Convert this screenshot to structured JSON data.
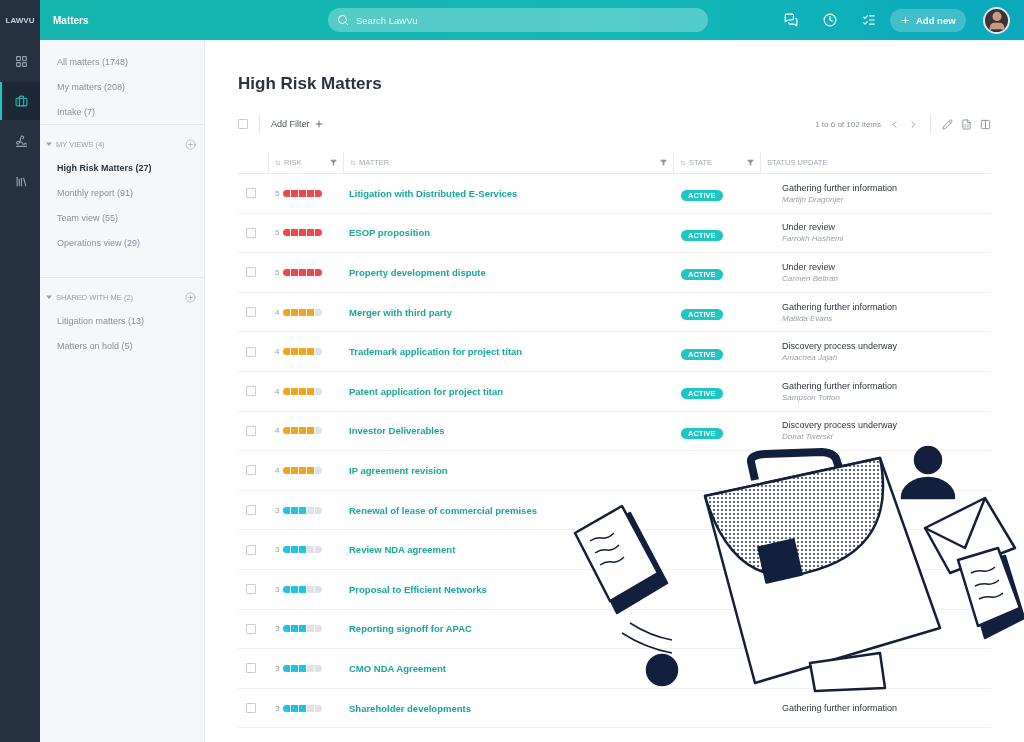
{
  "logo": "LAWVU",
  "nav_rail": [
    {
      "kind": "grid",
      "selected": false
    },
    {
      "kind": "briefcase",
      "selected": true
    },
    {
      "kind": "signature",
      "selected": false
    },
    {
      "kind": "library",
      "selected": false
    }
  ],
  "top_bar": {
    "title": "Matters",
    "search": {
      "placeholder": "Search LawVu"
    },
    "add_button": "Add new"
  },
  "sidebar": {
    "items": [
      {
        "label": "All matters (1748)",
        "selected": false
      },
      {
        "label": "My matters (208)",
        "selected": false
      },
      {
        "label": "Intake (7)",
        "selected": false
      }
    ],
    "sections": [
      {
        "title": "MY VIEWS (4)",
        "expanded": true,
        "items": [
          {
            "label": "High Risk Matters (27)",
            "selected": true
          },
          {
            "label": "Monthly report (91)",
            "selected": false
          },
          {
            "label": "Team view (55)",
            "selected": false
          },
          {
            "label": "Operations view (29)",
            "selected": false
          }
        ]
      },
      {
        "title": "SHARED WITH ME (2)",
        "expanded": true,
        "items": [
          {
            "label": "Litigation matters (13)",
            "selected": false
          },
          {
            "label": "Matters on hold (5)",
            "selected": false
          }
        ]
      }
    ]
  },
  "page_title": "High Risk Matters",
  "toolbar": {
    "select_all": {
      "checked": false
    },
    "add_filter": "Add Filter",
    "pagination": "1 to 6 of 102 items"
  },
  "table": {
    "columns": [
      "RISK",
      "MATTER",
      "STATE",
      "STATUS UPDATE"
    ],
    "rows": [
      {
        "checked": false,
        "risk": "5",
        "level": 1,
        "matter": "Litigation with Distributed E-Services",
        "state": "ACTIVE",
        "status": "Gathering further information",
        "author": "Martijn Dragonjer"
      },
      {
        "checked": false,
        "risk": "5",
        "level": 1,
        "matter": "ESOP proposition",
        "state": "ACTIVE",
        "status": "Under review",
        "author": "Farrokh Hashemi"
      },
      {
        "checked": false,
        "risk": "5",
        "level": 1,
        "matter": "Property development dispute",
        "state": "ACTIVE",
        "status": "Under review",
        "author": "Carmen Beltrán"
      },
      {
        "checked": false,
        "risk": "4",
        "level": 0.8,
        "matter": "Merger with third party",
        "state": "ACTIVE",
        "status": "Gathering further information",
        "author": "Matilda Evans"
      },
      {
        "checked": false,
        "risk": "4",
        "level": 0.8,
        "matter": "Trademark application for project titan",
        "state": "ACTIVE",
        "status": "Discovery process underway",
        "author": "Amachea Jajah"
      },
      {
        "checked": false,
        "risk": "4",
        "level": 0.8,
        "matter": "Patent application for project titan",
        "state": "ACTIVE",
        "status": "Gathering further information",
        "author": "Sampson Totton"
      },
      {
        "checked": false,
        "risk": "4",
        "level": 0.8,
        "matter": "Investor Deliverables",
        "state": "ACTIVE",
        "status": "Discovery process underway",
        "author": "Donat Twerski"
      },
      {
        "checked": false,
        "risk": "4",
        "level": 0.8,
        "matter": "IP agreement revision"
      },
      {
        "checked": false,
        "risk": "3",
        "level": 0.6,
        "matter": "Renewal of lease of commercial premises"
      },
      {
        "checked": false,
        "risk": "3",
        "level": 0.6,
        "matter": "Review NDA agreement"
      },
      {
        "checked": false,
        "risk": "3",
        "level": 0.6,
        "matter": "Proposal to Efficient Networks"
      },
      {
        "checked": false,
        "risk": "3",
        "level": 0.6,
        "matter": "Reporting signoff for APAC"
      },
      {
        "checked": false,
        "risk": "3",
        "level": 0.6,
        "matter": "CMO NDA Agreement"
      },
      {
        "checked": false,
        "risk": "3",
        "level": 0.6,
        "matter": "Shareholder developments",
        "status": "Gathering further information"
      }
    ]
  }
}
